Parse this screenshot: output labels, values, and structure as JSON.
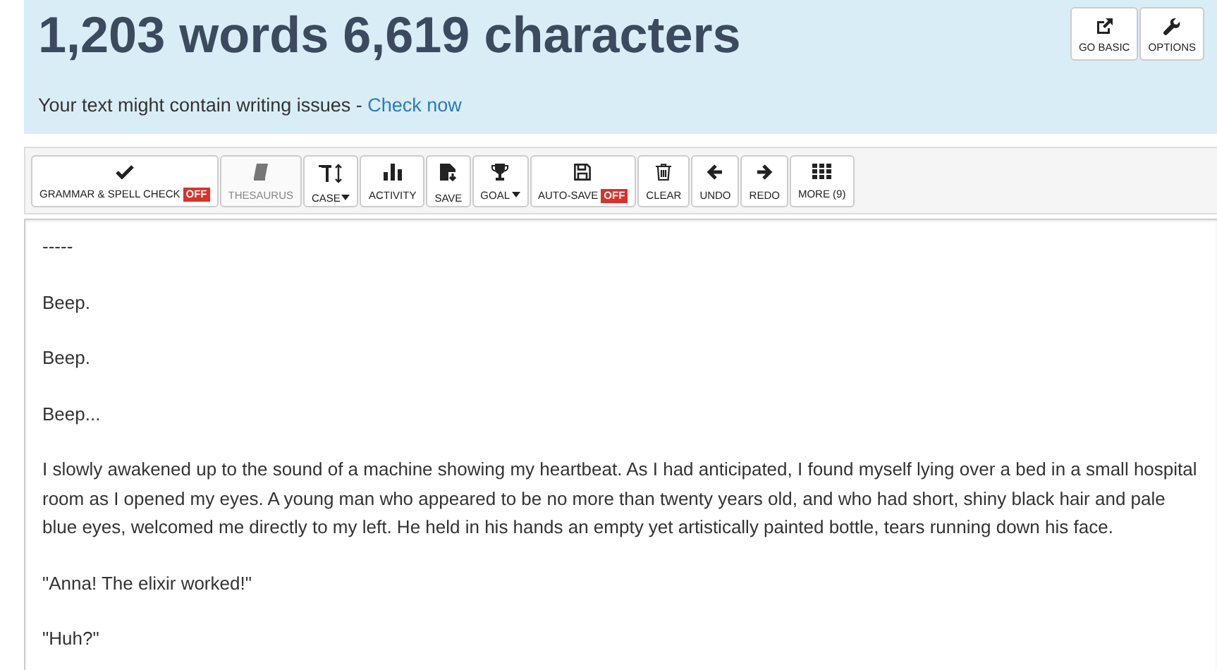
{
  "header": {
    "title": "1,203 words 6,619 characters",
    "notice": "Your text might contain writing issues - ",
    "notice_link": "Check now",
    "buttons": [
      {
        "label": "GO BASIC"
      },
      {
        "label": "OPTIONS"
      }
    ]
  },
  "toolbar": [
    {
      "label": "GRAMMAR & SPELL CHECK",
      "badge": "OFF",
      "disabled": false,
      "dropdown": false
    },
    {
      "label": "THESAURUS",
      "disabled": true,
      "dropdown": false
    },
    {
      "label": "CASE",
      "disabled": false,
      "dropdown": true
    },
    {
      "label": "ACTIVITY",
      "disabled": false,
      "dropdown": false
    },
    {
      "label": "SAVE",
      "disabled": false,
      "dropdown": false
    },
    {
      "label": "GOAL",
      "disabled": false,
      "dropdown": true
    },
    {
      "label": "AUTO-SAVE",
      "badge": "OFF",
      "disabled": false,
      "dropdown": false
    },
    {
      "label": "CLEAR",
      "disabled": false,
      "dropdown": false
    },
    {
      "label": "UNDO",
      "disabled": false,
      "dropdown": false
    },
    {
      "label": "REDO",
      "disabled": false,
      "dropdown": false
    },
    {
      "label": "MORE (9)",
      "disabled": false,
      "dropdown": false
    }
  ],
  "editor": {
    "paragraphs": [
      "-----",
      "Beep.",
      "Beep.",
      "Beep...",
      "I slowly awakened up to the sound of a machine showing my heartbeat. As I had anticipated, I found myself lying over a bed in a small hospital room as I opened my eyes. A young man who appeared to be no more than twenty years old, and who had short, shiny black hair and pale blue eyes, welcomed me directly to my left. He held in his hands an empty yet artistically painted bottle, tears running down his face.",
      "\"Anna! The elixir worked!\"",
      "\"Huh?\""
    ]
  }
}
